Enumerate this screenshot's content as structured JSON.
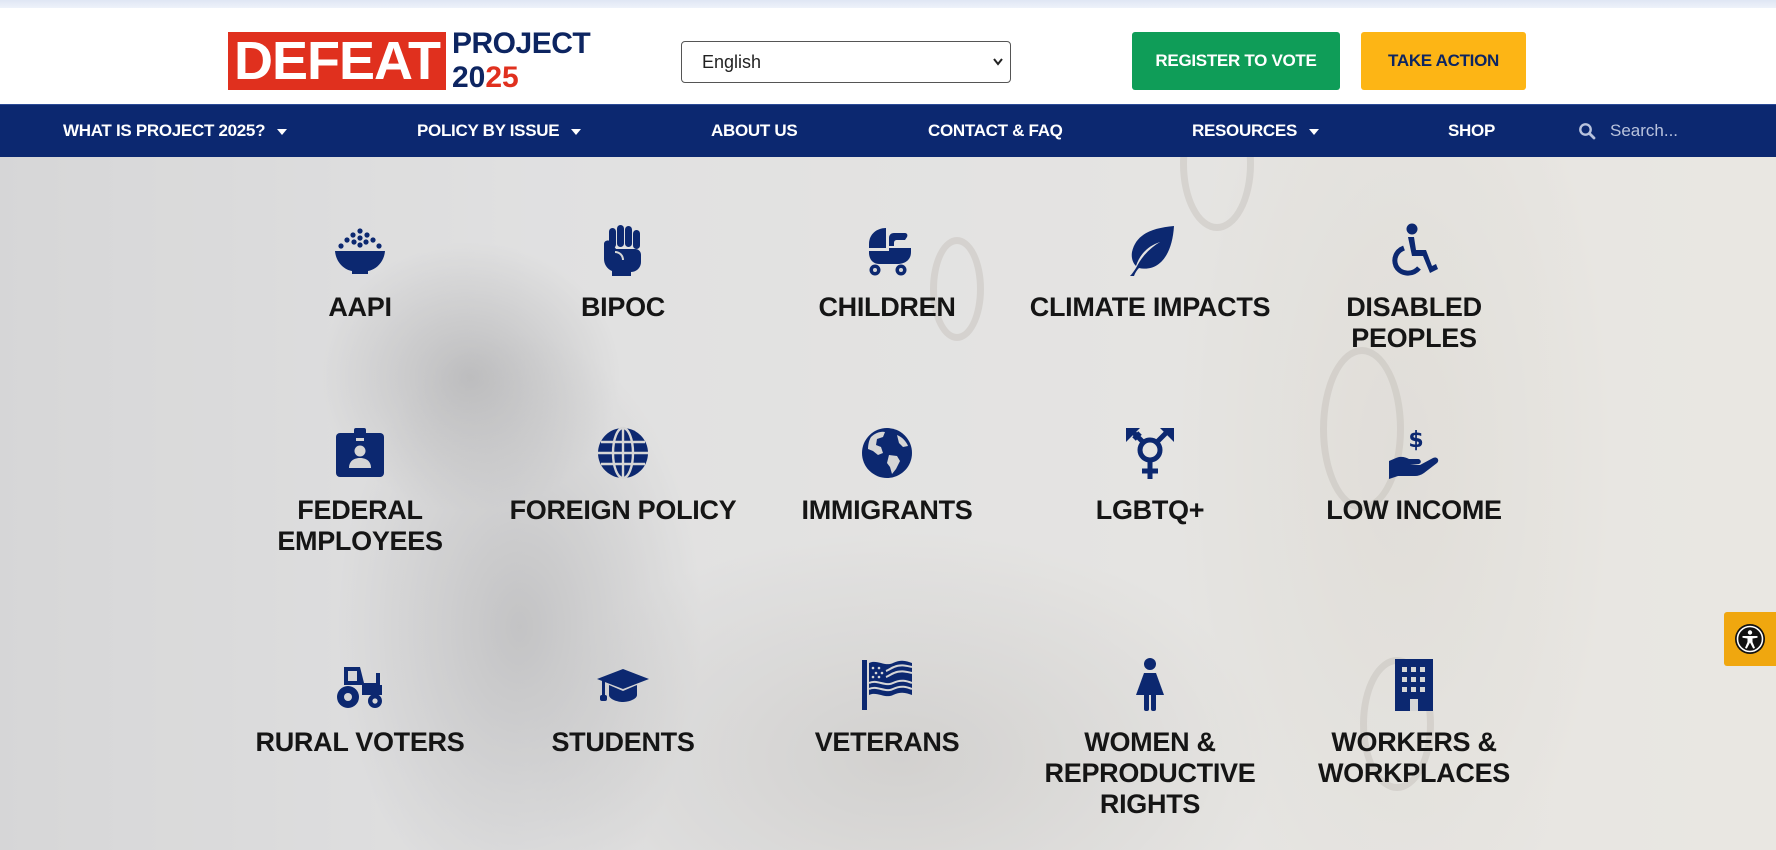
{
  "brand": {
    "defeat": "DEFEAT",
    "project": "PROJECT",
    "year_a": "20",
    "year_b": "25",
    "colors": {
      "red": "#e0301e",
      "navy": "#0c2870",
      "green": "#0f9d58",
      "gold": "#fdb515"
    }
  },
  "header": {
    "language": {
      "selected": "English"
    },
    "register_label": "REGISTER TO VOTE",
    "action_label": "TAKE ACTION"
  },
  "nav": {
    "items": [
      {
        "label": "WHAT IS PROJECT 2025?",
        "dropdown": true
      },
      {
        "label": "POLICY BY ISSUE",
        "dropdown": true
      },
      {
        "label": "ABOUT US",
        "dropdown": false
      },
      {
        "label": "CONTACT & FAQ",
        "dropdown": false
      },
      {
        "label": "RESOURCES",
        "dropdown": true
      },
      {
        "label": "SHOP",
        "dropdown": false
      }
    ],
    "search_placeholder": "Search..."
  },
  "categories": [
    {
      "label": "AAPI",
      "icon": "bowl-icon"
    },
    {
      "label": "BIPOC",
      "icon": "fist-icon"
    },
    {
      "label": "CHILDREN",
      "icon": "stroller-icon"
    },
    {
      "label": "CLIMATE IMPACTS",
      "icon": "leaf-icon"
    },
    {
      "label": "DISABLED PEOPLES",
      "icon": "wheelchair-icon"
    },
    {
      "label": "FEDERAL EMPLOYEES",
      "icon": "id-badge-icon"
    },
    {
      "label": "FOREIGN POLICY",
      "icon": "globe-icon"
    },
    {
      "label": "IMMIGRANTS",
      "icon": "earth-americas-icon"
    },
    {
      "label": "LGBTQ+",
      "icon": "transgender-icon"
    },
    {
      "label": "LOW INCOME",
      "icon": "hand-dollar-icon"
    },
    {
      "label": "RURAL VOTERS",
      "icon": "tractor-icon"
    },
    {
      "label": "STUDENTS",
      "icon": "graduation-cap-icon"
    },
    {
      "label": "VETERANS",
      "icon": "flag-usa-icon"
    },
    {
      "label": "WOMEN & REPRODUCTIVE RIGHTS",
      "icon": "person-dress-icon"
    },
    {
      "label": "WORKERS & WORKPLACES",
      "icon": "building-icon"
    }
  ],
  "accessibility": {
    "icon": "accessibility-icon"
  }
}
